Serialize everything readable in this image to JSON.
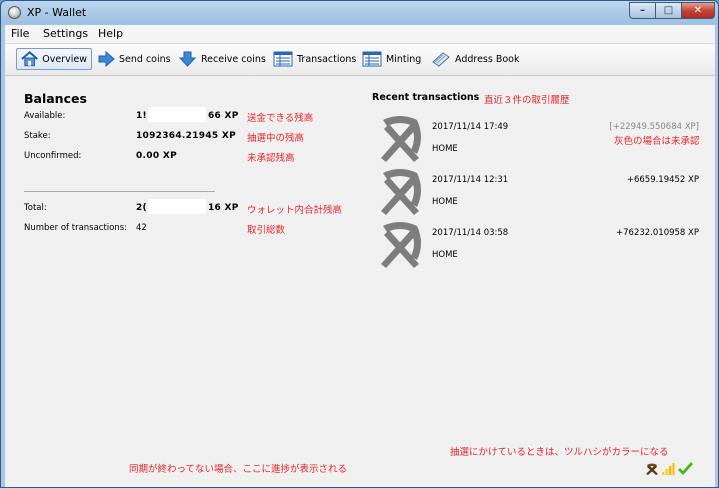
{
  "window": {
    "title": "XP - Wallet"
  },
  "menu": [
    "File",
    "Settings",
    "Help"
  ],
  "toolbar": {
    "overview": "Overview",
    "send": "Send coins",
    "receive": "Receive coins",
    "transactions": "Transactions",
    "minting": "Minting",
    "address_book": "Address Book"
  },
  "balances": {
    "heading": "Balances",
    "available_label": "Available:",
    "available_value_start": "1!",
    "available_value_end": "66 XP",
    "available_note": "送金できる残高",
    "stake_label": "Stake:",
    "stake_value": "1092364.21945 XP",
    "stake_note": "抽選中の残高",
    "unconfirmed_label": "Unconfirmed:",
    "unconfirmed_value": "0.00 XP",
    "unconfirmed_note": "未承認残高",
    "total_label": "Total:",
    "total_value_start": "2(",
    "total_value_end": "16 XP",
    "total_note": "ウォレット内合計残高",
    "tx_count_label": "Number of transactions:",
    "tx_count_value": "42",
    "tx_count_note": "取引総数"
  },
  "recent": {
    "heading": "Recent transactions",
    "heading_note": "直近３件の取引履歴",
    "items": [
      {
        "date": "2017/11/14 17:49",
        "address": "HOME",
        "amount": "[+22949.550684 XP]",
        "unconfirmed": true
      },
      {
        "date": "2017/11/14 12:31",
        "address": "HOME",
        "amount": "+6659.19452 XP",
        "unconfirmed": false
      },
      {
        "date": "2017/11/14 03:58",
        "address": "HOME",
        "amount": "+76232.010958 XP",
        "unconfirmed": false
      }
    ],
    "gray_note": "灰色の場合は未承認"
  },
  "notes": {
    "sync": "同期が終わってない場合、ここに進捗が表示される",
    "minting": "抽選にかけているときは、ツルハシがカラーになる"
  },
  "colors": {
    "annotation": "#e8262a",
    "unconfirmed": "#888888",
    "status_ok": "#46b51f"
  }
}
